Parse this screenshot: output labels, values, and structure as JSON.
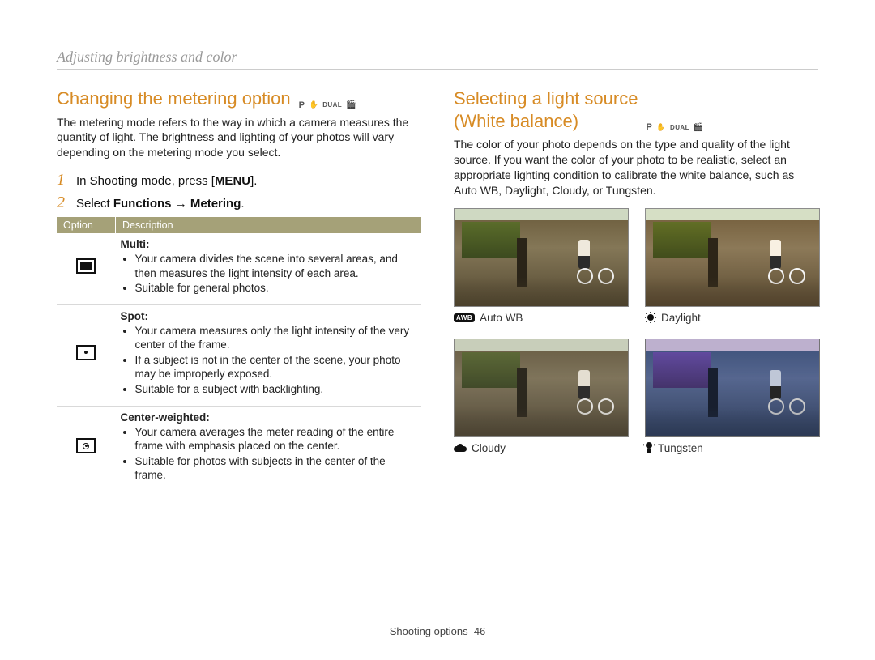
{
  "page_header": "Adjusting brightness and color",
  "mode_badges": {
    "p": "P",
    "dual": "DUAL"
  },
  "left": {
    "title": "Changing the metering option",
    "intro": "The metering mode refers to the way in which a camera measures the quantity of light. The brightness and lighting of your photos will vary depending on the metering mode you select.",
    "steps": {
      "1": {
        "num": "1",
        "prefix": "In Shooting mode, press [",
        "menu": "MENU",
        "suffix": "]."
      },
      "2": {
        "num": "2",
        "prefix": "Select ",
        "bold1": "Functions",
        "arrow": " → ",
        "bold2": "Metering",
        "suffix": "."
      }
    },
    "table": {
      "headers": {
        "option": "Option",
        "desc": "Description"
      },
      "rows": [
        {
          "name": "Multi",
          "bullets": [
            "Your camera divides the scene into several areas, and then measures the light intensity of each area.",
            "Suitable for general photos."
          ]
        },
        {
          "name": "Spot",
          "bullets": [
            "Your camera measures only the light intensity of the very center of the frame.",
            "If a subject is not in the center of the scene, your photo may be improperly exposed.",
            "Suitable for a subject with backlighting."
          ]
        },
        {
          "name": "Center-weighted",
          "bullets": [
            "Your camera averages the meter reading of the entire frame with emphasis placed on the center.",
            "Suitable for photos with subjects in the center of the frame."
          ]
        }
      ]
    }
  },
  "right": {
    "title_line1": "Selecting a light source",
    "title_line2": "(White balance)",
    "intro": "The color of your photo depends on the type and quality of the light source. If you want the color of your photo to be realistic, select an appropriate lighting condition to calibrate the white balance, such as Auto WB, Daylight, Cloudy, or Tungsten.",
    "samples": [
      {
        "icon": "awb",
        "label": "Auto WB"
      },
      {
        "icon": "sun",
        "label": "Daylight"
      },
      {
        "icon": "cloud",
        "label": "Cloudy"
      },
      {
        "icon": "tung",
        "label": "Tungsten"
      }
    ]
  },
  "footer": {
    "section": "Shooting options",
    "page": "46"
  }
}
